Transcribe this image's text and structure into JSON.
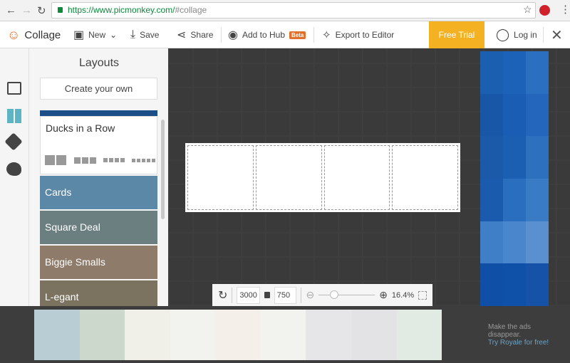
{
  "browser": {
    "url_host": "https://www.picmonkey.com/",
    "url_path": "#collage"
  },
  "header": {
    "app": "Collage",
    "new": "New",
    "save": "Save",
    "share": "Share",
    "hub": "Add to Hub",
    "beta": "Beta",
    "export": "Export to Editor",
    "trial": "Free Trial",
    "login": "Log in"
  },
  "panel": {
    "title": "Layouts",
    "create": "Create your own",
    "active": "Ducks in a Row",
    "tiles": [
      {
        "label": "Cards",
        "color": "#5c88a8"
      },
      {
        "label": "Square Deal",
        "color": "#6b7f80"
      },
      {
        "label": "Biggie Smalls",
        "color": "#8e7b6a"
      },
      {
        "label": "L-egant",
        "color": "#7b7360"
      }
    ]
  },
  "toolbar": {
    "width": "3000",
    "height": "750",
    "zoom": "16.4%",
    "zoom_level": 0.2
  },
  "ad": {
    "line1": "Make the ads",
    "line2": "disappear.",
    "link": "Try Royale for free!",
    "swatches": [
      "#b9cdd4",
      "#cdd8cd",
      "#f0f0e8",
      "#f2f3ee",
      "#f4efe8",
      "#f2f3ee",
      "#e6e6e8",
      "#e3e3e5",
      "#e1ebe3"
    ],
    "blues": [
      "#1a5fb0",
      "#1c62b8",
      "#2a6fc0",
      "#1856a8",
      "#1a5db5",
      "#2466bb",
      "#1a5aa8",
      "#1b5fb3",
      "#2d70be",
      "#1a5bae",
      "#2a6ec0",
      "#3a7bc6",
      "#3e7fc8",
      "#4a86cc",
      "#5a90d0",
      "#0f4fa5",
      "#0f50a8",
      "#1552a8"
    ]
  }
}
